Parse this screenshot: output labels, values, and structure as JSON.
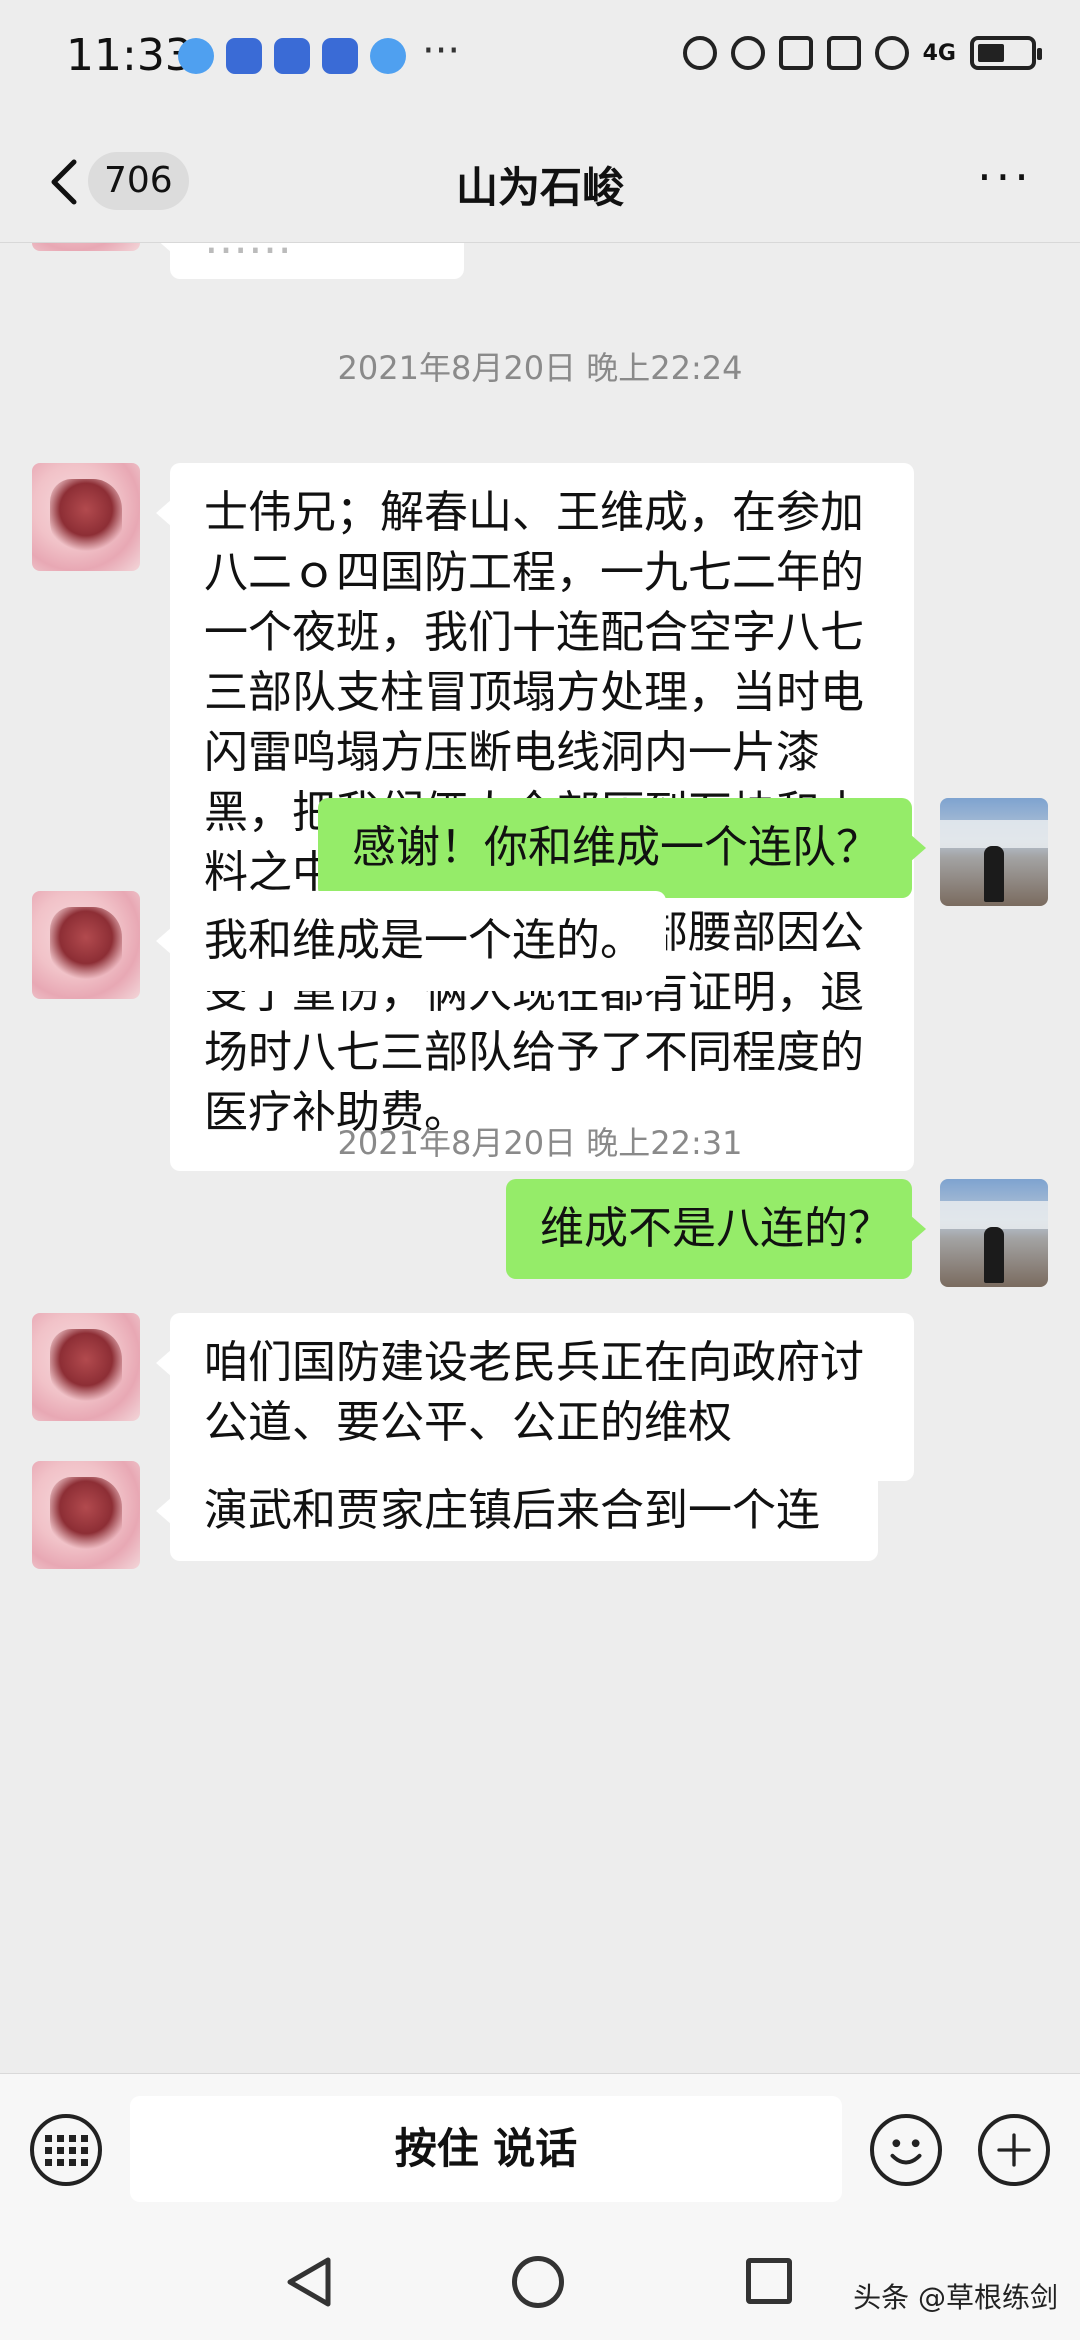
{
  "status_bar": {
    "time": "11:33",
    "more_notifications": "···",
    "network_label": "4G"
  },
  "header": {
    "unread_count": "706",
    "title": "山为石峻",
    "more_label": "···"
  },
  "messages": [
    {
      "type": "partial",
      "side": "left",
      "text": "……"
    },
    {
      "type": "time",
      "text": "2021年8月20日 晚上22:24"
    },
    {
      "type": "msg",
      "side": "left",
      "lines": [
        "士伟兄；解春山、王维成，在参加",
        "八二ｏ四国防工程，一九七二年的",
        "一个夜班，我们十连配合空字八七",
        "三部队支柱冒顶塌方处理，当时电",
        "闪雷鸣塌方压断电线洞内一片漆",
        "黑，把我们俩人全部压到石块和木",
        "料之中，经连队抢救人员救出时，",
        "俩人根本不醒人事，头部腰部因公",
        "受了重伤，俩人现在都有证明，退",
        "场时八七三部队给予了不同程度的",
        "医疗补助费。"
      ]
    },
    {
      "type": "msg",
      "side": "right",
      "lines": [
        "感谢！你和维成一个连队？"
      ]
    },
    {
      "type": "msg",
      "side": "left",
      "lines": [
        "我和维成是一个连的。"
      ]
    },
    {
      "type": "time",
      "text": "2021年8月20日 晚上22:31"
    },
    {
      "type": "msg",
      "side": "right",
      "lines": [
        "维成不是八连的？"
      ]
    },
    {
      "type": "msg",
      "side": "left",
      "lines": [
        "咱们国防建设老民兵正在向政府讨",
        "公道、要公平、公正的维权"
      ]
    },
    {
      "type": "msg",
      "side": "left",
      "lines": [
        "演武和贾家庄镇后来合到一个连"
      ]
    }
  ],
  "input_bar": {
    "hold_to_talk": "按住 说话"
  },
  "watermark": "头条 @草根练剑",
  "colors": {
    "background": "#ededed",
    "sent_bubble": "#95ec69",
    "received_bubble": "#ffffff"
  }
}
